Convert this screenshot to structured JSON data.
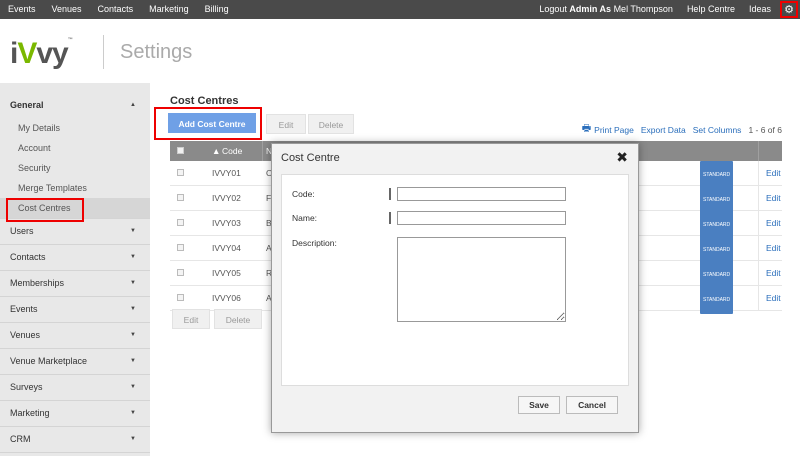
{
  "topnav": {
    "left": [
      "Events",
      "Venues",
      "Contacts",
      "Marketing",
      "Billing"
    ],
    "logout_prefix": "Logout",
    "admin_as": "Admin As",
    "user": "Mel Thompson",
    "help": "Help Centre",
    "ideas": "Ideas",
    "settings_icon": "gear-icon"
  },
  "header": {
    "logo_i": "i",
    "logo_v": "V",
    "logo_rest": "vy",
    "logo_tm": "™",
    "title": "Settings"
  },
  "sidebar": {
    "general": "General",
    "general_items": [
      "My Details",
      "Account",
      "Security",
      "Merge Templates",
      "Cost Centres"
    ],
    "sections": [
      "Users",
      "Contacts",
      "Memberships",
      "Events",
      "Venues",
      "Venue Marketplace",
      "Surveys",
      "Marketing",
      "CRM"
    ]
  },
  "main": {
    "section_title": "Cost Centres",
    "add_button": "Add Cost Centre",
    "edit_button": "Edit",
    "delete_button": "Delete",
    "print": "Print Page",
    "export": "Export Data",
    "set_columns": "Set Columns",
    "page_count": "1 - 6 of 6",
    "table": {
      "col_code": "Code",
      "col_name_partial": "N",
      "sort_icon": "sort-up-icon",
      "rows": [
        {
          "code": "IVVY01",
          "name": "O",
          "badge": "STANDARD",
          "edit": "Edit"
        },
        {
          "code": "IVVY02",
          "name": "F",
          "badge": "STANDARD",
          "edit": "Edit"
        },
        {
          "code": "IVVY03",
          "name": "B",
          "badge": "STANDARD",
          "edit": "Edit"
        },
        {
          "code": "IVVY04",
          "name": "A",
          "badge": "STANDARD",
          "edit": "Edit"
        },
        {
          "code": "IVVY05",
          "name": "R",
          "badge": "STANDARD",
          "edit": "Edit"
        },
        {
          "code": "IVVY06",
          "name": "A",
          "badge": "STANDARD",
          "edit": "Edit"
        }
      ]
    }
  },
  "modal": {
    "title": "Cost Centre",
    "code_label": "Code:",
    "name_label": "Name:",
    "description_label": "Description:",
    "code_value": "",
    "name_value": "",
    "description_value": "",
    "save": "Save",
    "cancel": "Cancel"
  },
  "colors": {
    "topnav_bg": "#4a4a4a",
    "sidebar_bg": "#e8e8e8",
    "primary_button": "#6fa0e6",
    "badge": "#4a7fc1",
    "link": "#2a6ebb",
    "highlight": "#ee0000"
  }
}
